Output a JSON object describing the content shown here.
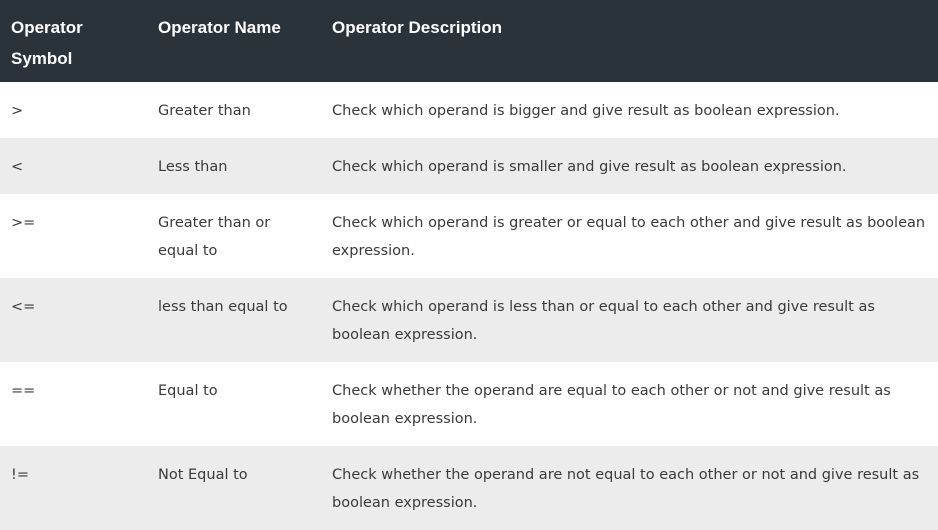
{
  "table": {
    "headers": [
      "Operator\nSymbol",
      "Operator Name",
      "Operator Description"
    ],
    "header_symbol_line1": "Operator",
    "header_symbol_line2": "Symbol",
    "header_name": "Operator Name",
    "header_description": "Operator Description",
    "rows": [
      {
        "symbol": ">",
        "name": "Greater than",
        "description": "Check which operand is bigger and give result as boolean expression."
      },
      {
        "symbol": "<",
        "name": "Less than",
        "description": "Check which operand is smaller and give result as boolean expression."
      },
      {
        "symbol": ">=",
        "name": "Greater than or equal to",
        "description": "Check which operand is greater or equal to each other and give result as boolean expression."
      },
      {
        "symbol": "<=",
        "name": "less than equal to",
        "description": "Check which operand is less than or equal to each other and give result as boolean expression."
      },
      {
        "symbol": "==",
        "name": "Equal to",
        "description": "Check whether the operand are equal to each other or not and give result as boolean expression."
      },
      {
        "symbol": "!=",
        "name": "Not Equal to",
        "description": "Check whether the operand are not equal to each other or not and give result as boolean expression."
      }
    ]
  },
  "colors": {
    "header_bg": "#2a323a",
    "header_text": "#ffffff",
    "row_alt_bg": "#ececec",
    "row_bg": "#ffffff",
    "body_text": "#3a3a3a"
  }
}
